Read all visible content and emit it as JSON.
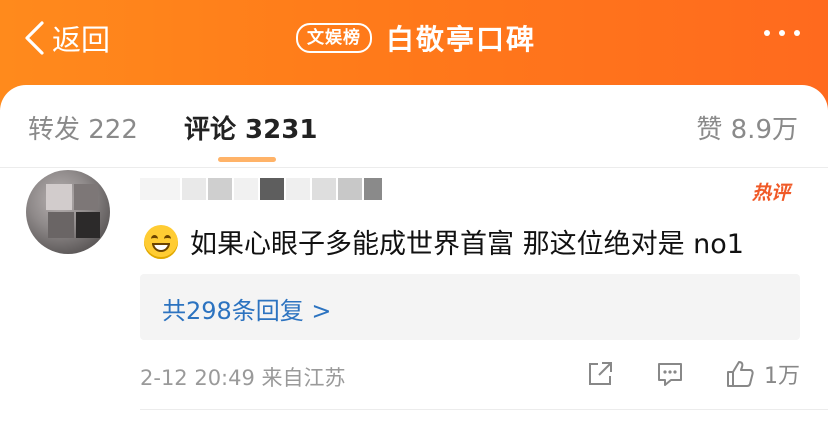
{
  "header": {
    "back_label": "返回",
    "brand_badge": "文娱榜",
    "title": "白敬亭口碑",
    "more_icon": "more-dots-icon",
    "background": "#ff7a1a"
  },
  "tabs": {
    "repost": "转发 222",
    "comment": "评论 3231",
    "like": "赞 8.9万",
    "active": "comment"
  },
  "comment": {
    "hot_tag": "热评",
    "emoji": "grinning-face-icon",
    "text": "如果心眼子多能成世界首富 那这位绝对是 no1",
    "replies_label": "共298条回复 >",
    "meta": "2-12 20:49 来自江苏",
    "like_count": "1万",
    "accent_link": "#2c73c0",
    "hot_color": "#f05a28"
  }
}
